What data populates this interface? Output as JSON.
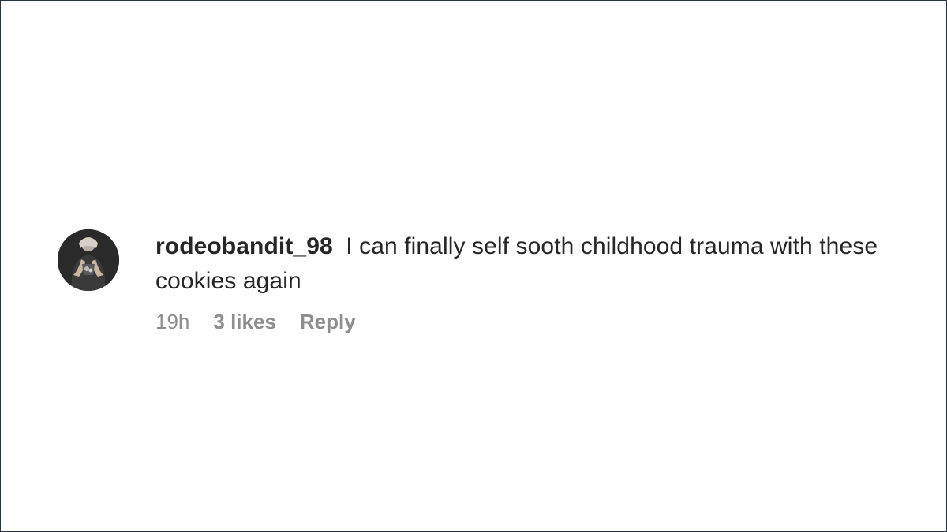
{
  "comment": {
    "username": "rodeobandit_98",
    "text": "I can finally self sooth childhood trauma with these cookies again",
    "timestamp": "19h",
    "likes": "3 likes",
    "reply_label": "Reply"
  },
  "avatar": {
    "description": "profile-picture"
  },
  "colors": {
    "background": "#ffffff",
    "border": "#2b3440",
    "text": "#262626",
    "meta": "#8e8e8e"
  }
}
